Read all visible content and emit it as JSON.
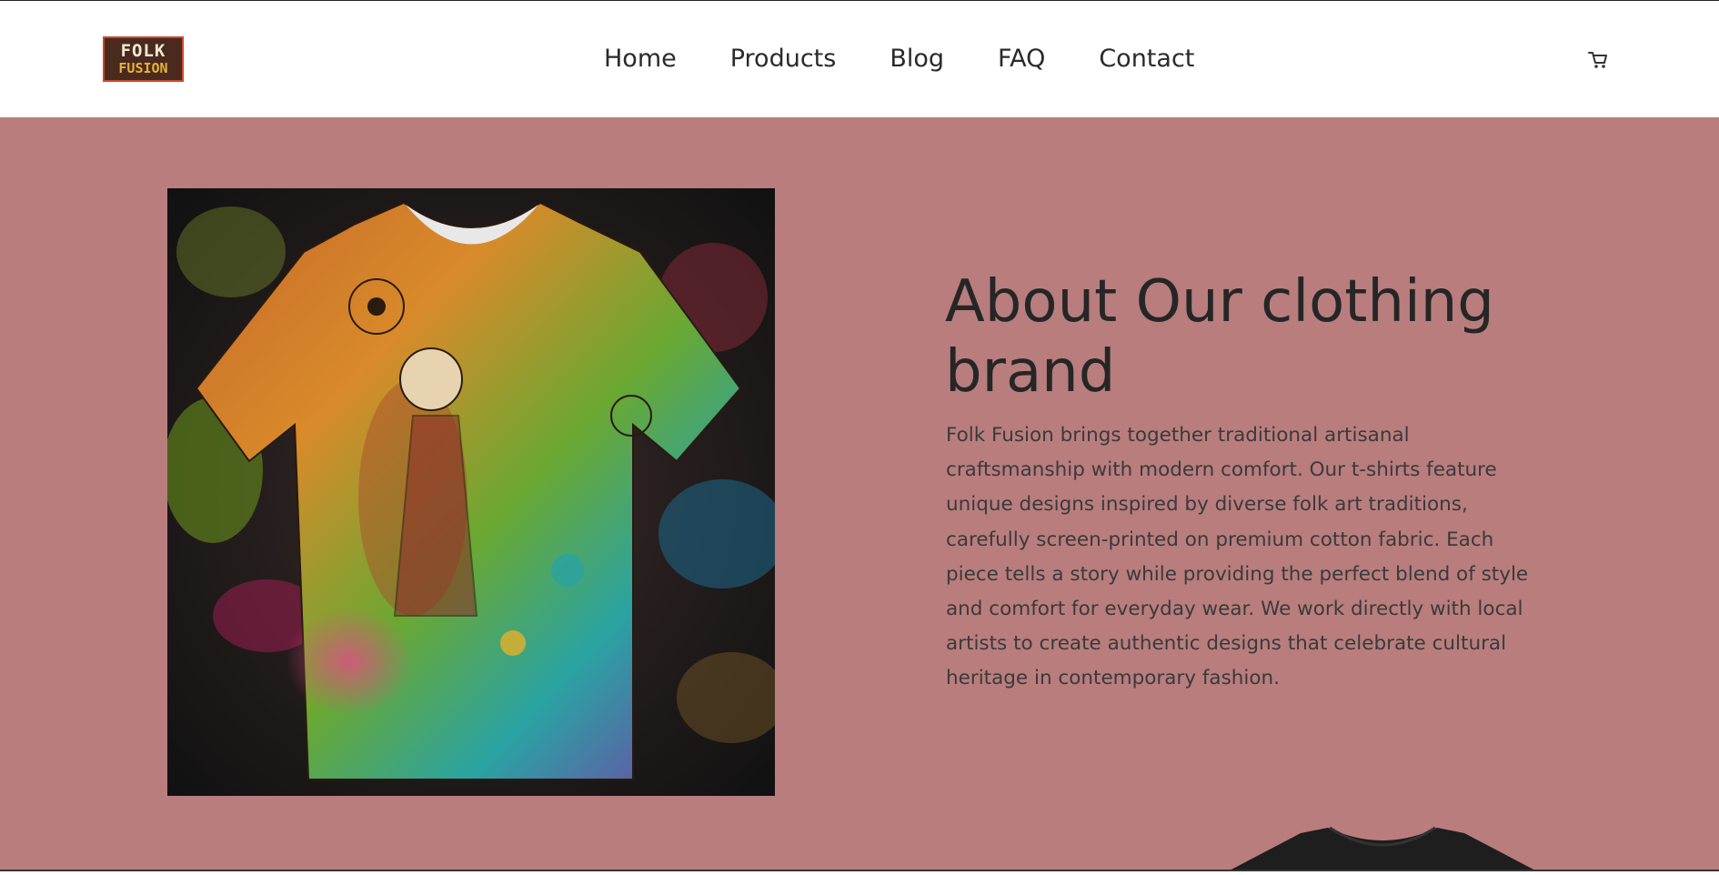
{
  "brand": {
    "logo_line1": "FOLK",
    "logo_line2": "FUSION"
  },
  "nav": {
    "items": [
      {
        "label": "Home"
      },
      {
        "label": "Products"
      },
      {
        "label": "Blog"
      },
      {
        "label": "FAQ"
      },
      {
        "label": "Contact"
      }
    ],
    "cart_icon": "cart-icon"
  },
  "about": {
    "title": "About Our clothing brand",
    "body": "Folk Fusion brings together traditional artisanal craftsmanship with modern comfort. Our t-shirts feature unique designs inspired by diverse folk art traditions, carefully screen-printed on premium cotton fabric. Each piece tells a story while providing the perfect blend of style and comfort for everyday wear. We work directly with local artists to create authentic designs that celebrate cultural heritage in contemporary fashion.",
    "image_icon": "folk-art-tshirt-image"
  },
  "colors": {
    "hero_bg": "#b97d7d",
    "header_bg": "#ffffff",
    "text_dark": "#262626"
  }
}
